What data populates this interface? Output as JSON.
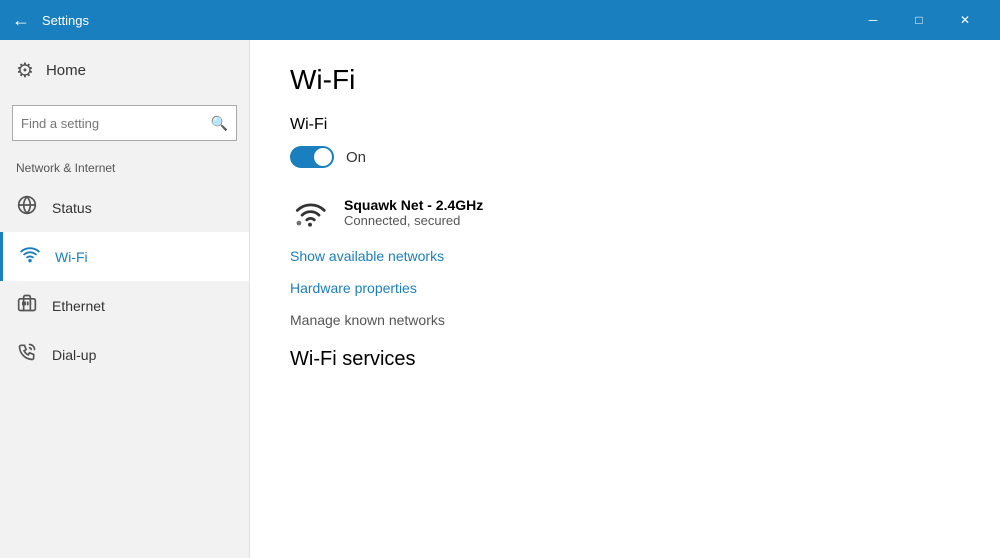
{
  "titlebar": {
    "title": "Settings",
    "back_label": "←",
    "minimize_label": "─",
    "maximize_label": "□",
    "close_label": "✕"
  },
  "sidebar": {
    "home_label": "Home",
    "search_placeholder": "Find a setting",
    "section_label": "Network & Internet",
    "items": [
      {
        "id": "status",
        "label": "Status",
        "icon": "🌐"
      },
      {
        "id": "wifi",
        "label": "Wi-Fi",
        "icon": "wifi",
        "active": true
      },
      {
        "id": "ethernet",
        "label": "Ethernet",
        "icon": "🖥"
      },
      {
        "id": "dialup",
        "label": "Dial-up",
        "icon": "📞"
      }
    ]
  },
  "content": {
    "page_title": "Wi-Fi",
    "wifi_section_label": "Wi-Fi",
    "toggle_state": "On",
    "network_name": "Squawk Net - 2.4GHz",
    "network_status": "Connected, secured",
    "show_networks_link": "Show available networks",
    "hardware_properties_link": "Hardware properties",
    "manage_networks_label": "Manage known networks",
    "wifi_services_title": "Wi-Fi services"
  }
}
